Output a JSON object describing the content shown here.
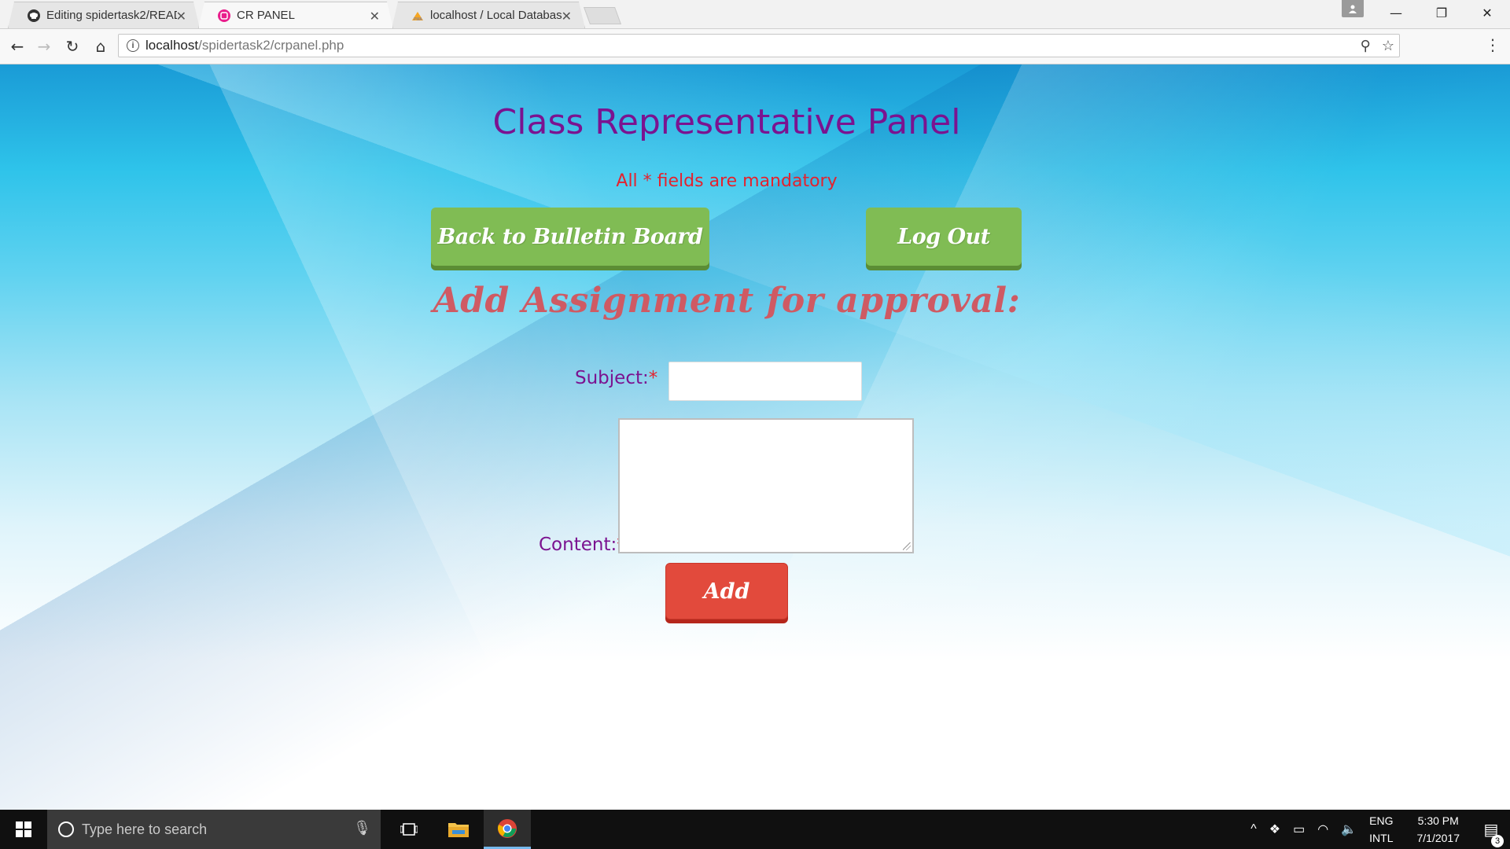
{
  "browser": {
    "tabs": [
      {
        "title": "Editing spidertask2/READ",
        "icon": "github-icon"
      },
      {
        "title": "CR PANEL",
        "icon": "app-icon"
      },
      {
        "title": "localhost / Local Databas",
        "icon": "phpmyadmin-icon"
      }
    ],
    "url_host": "localhost",
    "url_path": "/spidertask2/crpanel.php"
  },
  "page": {
    "title": "Class Representative Panel",
    "mandatory_note": "All * fields are mandatory",
    "back_button": "Back to Bulletin Board",
    "logout_button": "Log Out",
    "section_heading": "Add Assignment for approval:",
    "subject_label": "Subject:",
    "content_label": "Content:",
    "required_marker": "*",
    "subject_value": "",
    "content_value": "",
    "add_button": "Add"
  },
  "taskbar": {
    "search_placeholder": "Type here to search",
    "lang_top": "ENG",
    "lang_bottom": "INTL",
    "time": "5:30 PM",
    "date": "7/1/2017",
    "notification_count": "3"
  },
  "colors": {
    "title": "#7b1390",
    "mandatory": "#e4222e",
    "green_button": "#80bc54",
    "red_button": "#e24a3c",
    "heading": "#cf5a63"
  }
}
